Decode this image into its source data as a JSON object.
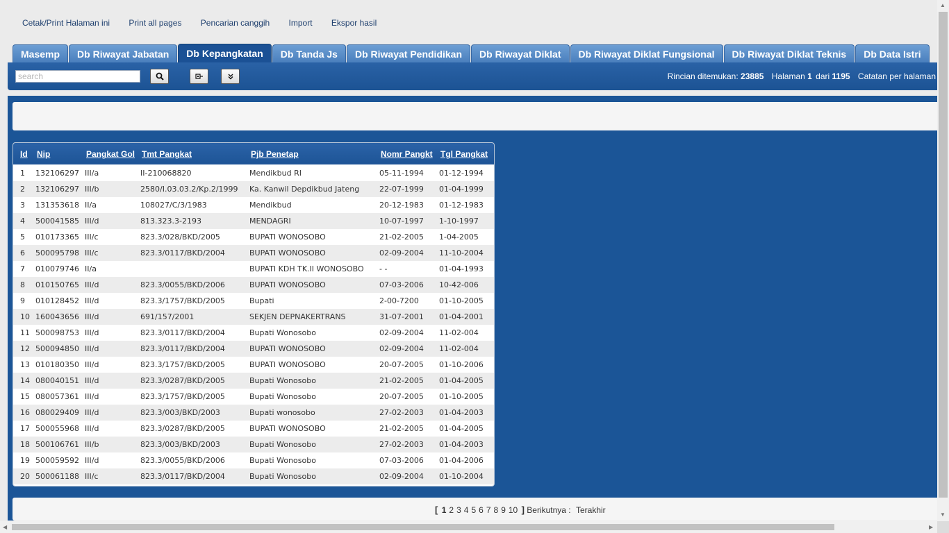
{
  "top_links": [
    "Cetak/Print Halaman ini",
    "Print all pages",
    "Pencarian canggih",
    "Import",
    "Ekspor hasil"
  ],
  "tabs": [
    "Masemp",
    "Db Riwayat Jabatan",
    "Db Kepangkatan",
    "Db Tanda Js",
    "Db Riwayat Pendidikan",
    "Db Riwayat Diklat",
    "Db Riwayat Diklat Fungsional",
    "Db Riwayat Diklat Teknis",
    "Db Data Istri"
  ],
  "active_tab": "Db Kepangkatan",
  "search": {
    "placeholder": "search"
  },
  "stats": {
    "found_label": "Rincian ditemukan:",
    "found_count": "23885",
    "page_label": "Halaman",
    "page_current": "1",
    "of_label": "dari",
    "page_total": "1195",
    "per_page_label": "Catatan per halaman"
  },
  "table": {
    "columns": [
      "Id",
      "Nip",
      "Pangkat Gol",
      "Tmt Pangkat",
      "Pjb Penetap",
      "Nomr Pangkt",
      "Tgl Pangkat"
    ],
    "rows": [
      [
        "1",
        "132106297",
        "III/a",
        "II-210068820",
        "Mendikbud RI",
        "05-11-1994",
        "01-12-1994"
      ],
      [
        "2",
        "132106297",
        "III/b",
        "2580/I.03.03.2/Kp.2/1999",
        "Ka. Kanwil Depdikbud Jateng",
        "22-07-1999",
        "01-04-1999"
      ],
      [
        "3",
        "131353618",
        "II/a",
        "108027/C/3/1983",
        "Mendikbud",
        "20-12-1983",
        "01-12-1983"
      ],
      [
        "4",
        "500041585",
        "III/d",
        "813.323.3-2193",
        "MENDAGRI",
        "10-07-1997",
        "1-10-1997"
      ],
      [
        "5",
        "010173365",
        "III/c",
        "823.3/028/BKD/2005",
        "BUPATI WONOSOBO",
        "21-02-2005",
        "1-04-2005"
      ],
      [
        "6",
        "500095798",
        "III/c",
        "823.3/0117/BKD/2004",
        "BUPATI WONOSOBO",
        "02-09-2004",
        "11-10-2004"
      ],
      [
        "7",
        "010079746",
        "II/a",
        "",
        "BUPATI KDH TK.II WONOSOBO",
        "- -",
        "01-04-1993"
      ],
      [
        "8",
        "010150765",
        "III/d",
        "823.3/0055/BKD/2006",
        "BUPATI WONOSOBO",
        "07-03-2006",
        "10-42-006"
      ],
      [
        "9",
        "010128452",
        "III/d",
        "823.3/1757/BKD/2005",
        "Bupati",
        "2-00-7200",
        "01-10-2005"
      ],
      [
        "10",
        "160043656",
        "III/d",
        "691/157/2001",
        "SEKJEN DEPNAKERTRANS",
        "31-07-2001",
        "01-04-2001"
      ],
      [
        "11",
        "500098753",
        "III/d",
        "823.3/0117/BKD/2004",
        "Bupati Wonosobo",
        "02-09-2004",
        "11-02-004"
      ],
      [
        "12",
        "500094850",
        "III/d",
        "823.3/0117/BKD/2004",
        "BUPATI WONOSOBO",
        "02-09-2004",
        "11-02-004"
      ],
      [
        "13",
        "010180350",
        "III/d",
        "823.3/1757/BKD/2005",
        "BUPATI WONOSOBO",
        "20-07-2005",
        "01-10-2006"
      ],
      [
        "14",
        "080040151",
        "III/d",
        "823.3/0287/BKD/2005",
        "Bupati Wonosobo",
        "21-02-2005",
        "01-04-2005"
      ],
      [
        "15",
        "080057361",
        "III/d",
        "823.3/1757/BKD/2005",
        "Bupati Wonosobo",
        "20-07-2005",
        "01-10-2005"
      ],
      [
        "16",
        "080029409",
        "III/d",
        "823.3/003/BKD/2003",
        "Bupati wonosobo",
        "27-02-2003",
        "01-04-2003"
      ],
      [
        "17",
        "500055968",
        "III/d",
        "823.3/0287/BKD/2005",
        "BUPATI WONOSOBO",
        "21-02-2005",
        "01-04-2005"
      ],
      [
        "18",
        "500106761",
        "III/b",
        "823.3/003/BKD/2003",
        "Bupati Wonosobo",
        "27-02-2003",
        "01-04-2003"
      ],
      [
        "19",
        "500059592",
        "III/d",
        "823.3/0055/BKD/2006",
        "Bupati Wonosobo",
        "07-03-2006",
        "01-04-2006"
      ],
      [
        "20",
        "500061188",
        "III/c",
        "823.3/0117/BKD/2004",
        "Bupati Wonosobo",
        "02-09-2004",
        "01-10-2004"
      ]
    ]
  },
  "pager": {
    "open_bracket": "[",
    "pages": [
      "1",
      "2",
      "3",
      "4",
      "5",
      "6",
      "7",
      "8",
      "9",
      "10"
    ],
    "current_page": "1",
    "close_bracket": "]",
    "next_label": "Berikutnya :",
    "last_label": "Terakhir"
  },
  "icons": {
    "search_button": "search-icon",
    "toggle_button": "toggle-panel-icon",
    "expand_button": "double-chevron-down-icon"
  }
}
